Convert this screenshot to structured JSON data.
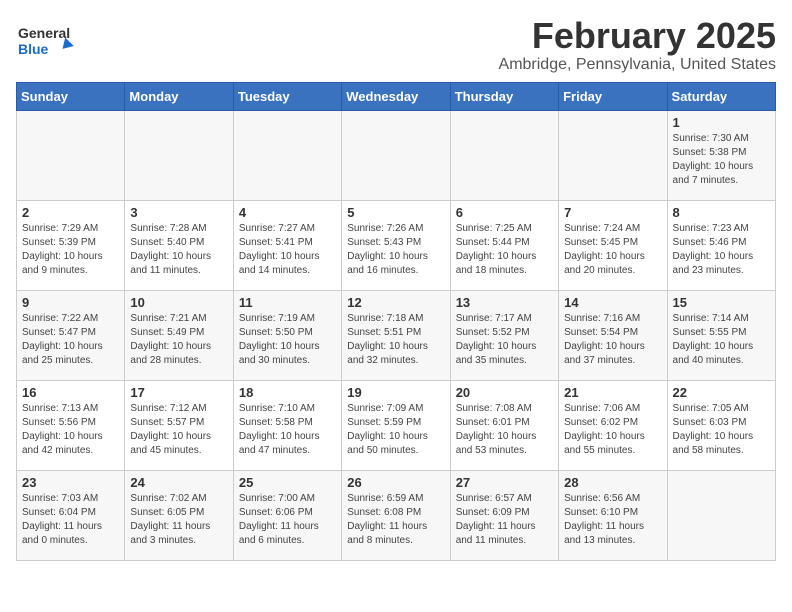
{
  "header": {
    "logo_general": "General",
    "logo_blue": "Blue",
    "title": "February 2025",
    "subtitle": "Ambridge, Pennsylvania, United States"
  },
  "days_of_week": [
    "Sunday",
    "Monday",
    "Tuesday",
    "Wednesday",
    "Thursday",
    "Friday",
    "Saturday"
  ],
  "weeks": [
    [
      {
        "day": "",
        "info": ""
      },
      {
        "day": "",
        "info": ""
      },
      {
        "day": "",
        "info": ""
      },
      {
        "day": "",
        "info": ""
      },
      {
        "day": "",
        "info": ""
      },
      {
        "day": "",
        "info": ""
      },
      {
        "day": "1",
        "info": "Sunrise: 7:30 AM\nSunset: 5:38 PM\nDaylight: 10 hours\nand 7 minutes."
      }
    ],
    [
      {
        "day": "2",
        "info": "Sunrise: 7:29 AM\nSunset: 5:39 PM\nDaylight: 10 hours\nand 9 minutes."
      },
      {
        "day": "3",
        "info": "Sunrise: 7:28 AM\nSunset: 5:40 PM\nDaylight: 10 hours\nand 11 minutes."
      },
      {
        "day": "4",
        "info": "Sunrise: 7:27 AM\nSunset: 5:41 PM\nDaylight: 10 hours\nand 14 minutes."
      },
      {
        "day": "5",
        "info": "Sunrise: 7:26 AM\nSunset: 5:43 PM\nDaylight: 10 hours\nand 16 minutes."
      },
      {
        "day": "6",
        "info": "Sunrise: 7:25 AM\nSunset: 5:44 PM\nDaylight: 10 hours\nand 18 minutes."
      },
      {
        "day": "7",
        "info": "Sunrise: 7:24 AM\nSunset: 5:45 PM\nDaylight: 10 hours\nand 20 minutes."
      },
      {
        "day": "8",
        "info": "Sunrise: 7:23 AM\nSunset: 5:46 PM\nDaylight: 10 hours\nand 23 minutes."
      }
    ],
    [
      {
        "day": "9",
        "info": "Sunrise: 7:22 AM\nSunset: 5:47 PM\nDaylight: 10 hours\nand 25 minutes."
      },
      {
        "day": "10",
        "info": "Sunrise: 7:21 AM\nSunset: 5:49 PM\nDaylight: 10 hours\nand 28 minutes."
      },
      {
        "day": "11",
        "info": "Sunrise: 7:19 AM\nSunset: 5:50 PM\nDaylight: 10 hours\nand 30 minutes."
      },
      {
        "day": "12",
        "info": "Sunrise: 7:18 AM\nSunset: 5:51 PM\nDaylight: 10 hours\nand 32 minutes."
      },
      {
        "day": "13",
        "info": "Sunrise: 7:17 AM\nSunset: 5:52 PM\nDaylight: 10 hours\nand 35 minutes."
      },
      {
        "day": "14",
        "info": "Sunrise: 7:16 AM\nSunset: 5:54 PM\nDaylight: 10 hours\nand 37 minutes."
      },
      {
        "day": "15",
        "info": "Sunrise: 7:14 AM\nSunset: 5:55 PM\nDaylight: 10 hours\nand 40 minutes."
      }
    ],
    [
      {
        "day": "16",
        "info": "Sunrise: 7:13 AM\nSunset: 5:56 PM\nDaylight: 10 hours\nand 42 minutes."
      },
      {
        "day": "17",
        "info": "Sunrise: 7:12 AM\nSunset: 5:57 PM\nDaylight: 10 hours\nand 45 minutes."
      },
      {
        "day": "18",
        "info": "Sunrise: 7:10 AM\nSunset: 5:58 PM\nDaylight: 10 hours\nand 47 minutes."
      },
      {
        "day": "19",
        "info": "Sunrise: 7:09 AM\nSunset: 5:59 PM\nDaylight: 10 hours\nand 50 minutes."
      },
      {
        "day": "20",
        "info": "Sunrise: 7:08 AM\nSunset: 6:01 PM\nDaylight: 10 hours\nand 53 minutes."
      },
      {
        "day": "21",
        "info": "Sunrise: 7:06 AM\nSunset: 6:02 PM\nDaylight: 10 hours\nand 55 minutes."
      },
      {
        "day": "22",
        "info": "Sunrise: 7:05 AM\nSunset: 6:03 PM\nDaylight: 10 hours\nand 58 minutes."
      }
    ],
    [
      {
        "day": "23",
        "info": "Sunrise: 7:03 AM\nSunset: 6:04 PM\nDaylight: 11 hours\nand 0 minutes."
      },
      {
        "day": "24",
        "info": "Sunrise: 7:02 AM\nSunset: 6:05 PM\nDaylight: 11 hours\nand 3 minutes."
      },
      {
        "day": "25",
        "info": "Sunrise: 7:00 AM\nSunset: 6:06 PM\nDaylight: 11 hours\nand 6 minutes."
      },
      {
        "day": "26",
        "info": "Sunrise: 6:59 AM\nSunset: 6:08 PM\nDaylight: 11 hours\nand 8 minutes."
      },
      {
        "day": "27",
        "info": "Sunrise: 6:57 AM\nSunset: 6:09 PM\nDaylight: 11 hours\nand 11 minutes."
      },
      {
        "day": "28",
        "info": "Sunrise: 6:56 AM\nSunset: 6:10 PM\nDaylight: 11 hours\nand 13 minutes."
      },
      {
        "day": "",
        "info": ""
      }
    ]
  ]
}
